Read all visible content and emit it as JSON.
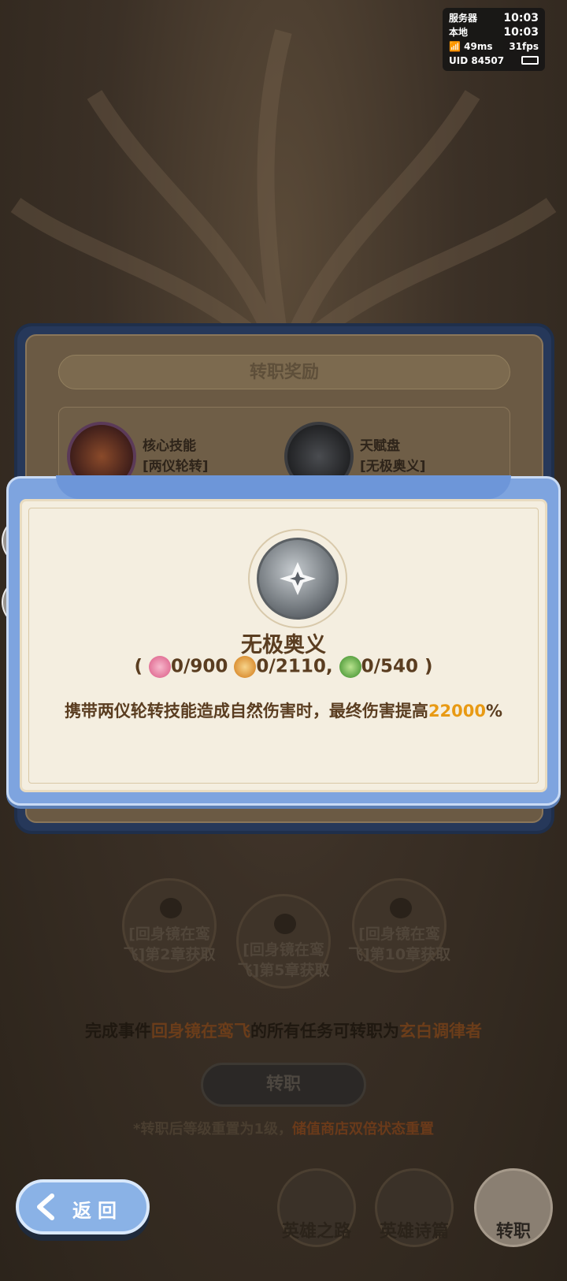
{
  "status_overlay": {
    "server_label": "服务器",
    "server_time": "10:03",
    "local_label": "本地",
    "local_time": "10:03",
    "ping": "49ms",
    "fps": "31fps",
    "uid": "UID 84507"
  },
  "background_dialog": {
    "title": "转职奖励",
    "skills": [
      {
        "label": "核心技能",
        "value": "[两仪轮转]"
      },
      {
        "label": "天赋盘",
        "value": "[无极奥义]"
      }
    ]
  },
  "locked_rewards": [
    {
      "line1": "[回身镜在鸾",
      "line2": "飞]第2章获取"
    },
    {
      "line1": "[回身镜在鸾",
      "line2": "飞]第5章获取"
    },
    {
      "line1": "[回身镜在鸾",
      "line2": "飞]第10章获取"
    }
  ],
  "event_text": {
    "prefix": "完成事件",
    "event_name": "回身镜在鸾飞",
    "middle": "的所有任务可转职为",
    "class_name": "玄白调律者"
  },
  "transfer_button_label": "转职",
  "note": {
    "prefix": "*转职后等级重置为1级，",
    "highlight": "储值商店双倍状态重置"
  },
  "nav": {
    "hero_road": "英雄之路",
    "hero_poem": "英雄诗篇",
    "transfer": "转职"
  },
  "back_button_label": "返回",
  "popup": {
    "title": "无极奥义",
    "cost_open": "(",
    "cost_close": ")",
    "costs": [
      {
        "icon": "pink-flower-icon",
        "text": "0/900"
      },
      {
        "icon": "orange-flower-icon",
        "text": "0/2110,"
      },
      {
        "icon": "green-bag-icon",
        "text": "0/540"
      }
    ],
    "description_prefix": "携带两仪轮转技能造成自然伤害时，最终伤害提高",
    "description_value": "22000",
    "description_suffix": "%"
  },
  "colors": {
    "accent_value": "#e89a14",
    "popup_blue": "#7ea4df",
    "parchment": "#f4eee0",
    "title_brown": "#5a3d20"
  }
}
